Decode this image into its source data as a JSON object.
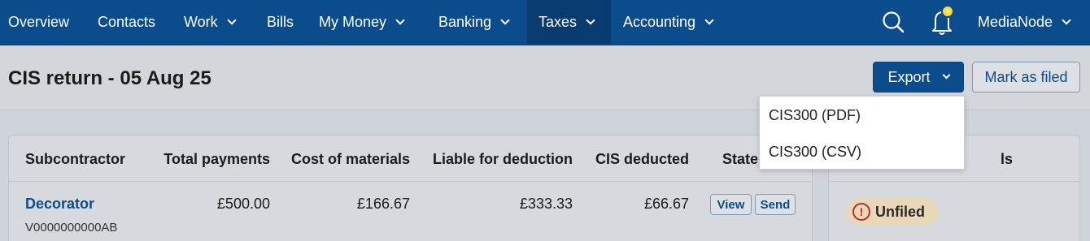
{
  "nav": {
    "items": [
      {
        "label": "Overview"
      },
      {
        "label": "Contacts"
      },
      {
        "label": "Work"
      },
      {
        "label": "Bills"
      },
      {
        "label": "My Money"
      },
      {
        "label": "Banking"
      },
      {
        "label": "Taxes"
      },
      {
        "label": "Accounting"
      }
    ],
    "account": "MediaNode",
    "accent": "#0b4d8c"
  },
  "page": {
    "title": "CIS return - 05 Aug 25",
    "export_label": "Export",
    "mark_filed_label": "Mark as filed"
  },
  "export_menu": {
    "options": [
      "CIS300 (PDF)",
      "CIS300 (CSV)"
    ]
  },
  "table": {
    "headers": [
      "Subcontractor",
      "Total payments",
      "Cost of materials",
      "Liable for deduction",
      "CIS deducted",
      "State"
    ],
    "rows": [
      {
        "name": "Decorator",
        "ref": "V0000000000AB",
        "total": "£500.00",
        "materials": "£166.67",
        "liable": "£333.33",
        "deducted": "£66.67",
        "view_label": "View",
        "send_label": "Send"
      }
    ]
  },
  "side": {
    "header": "ls",
    "status": "Unfiled",
    "status_color": "#e8d7b8",
    "status_icon": "exclamation-icon"
  }
}
